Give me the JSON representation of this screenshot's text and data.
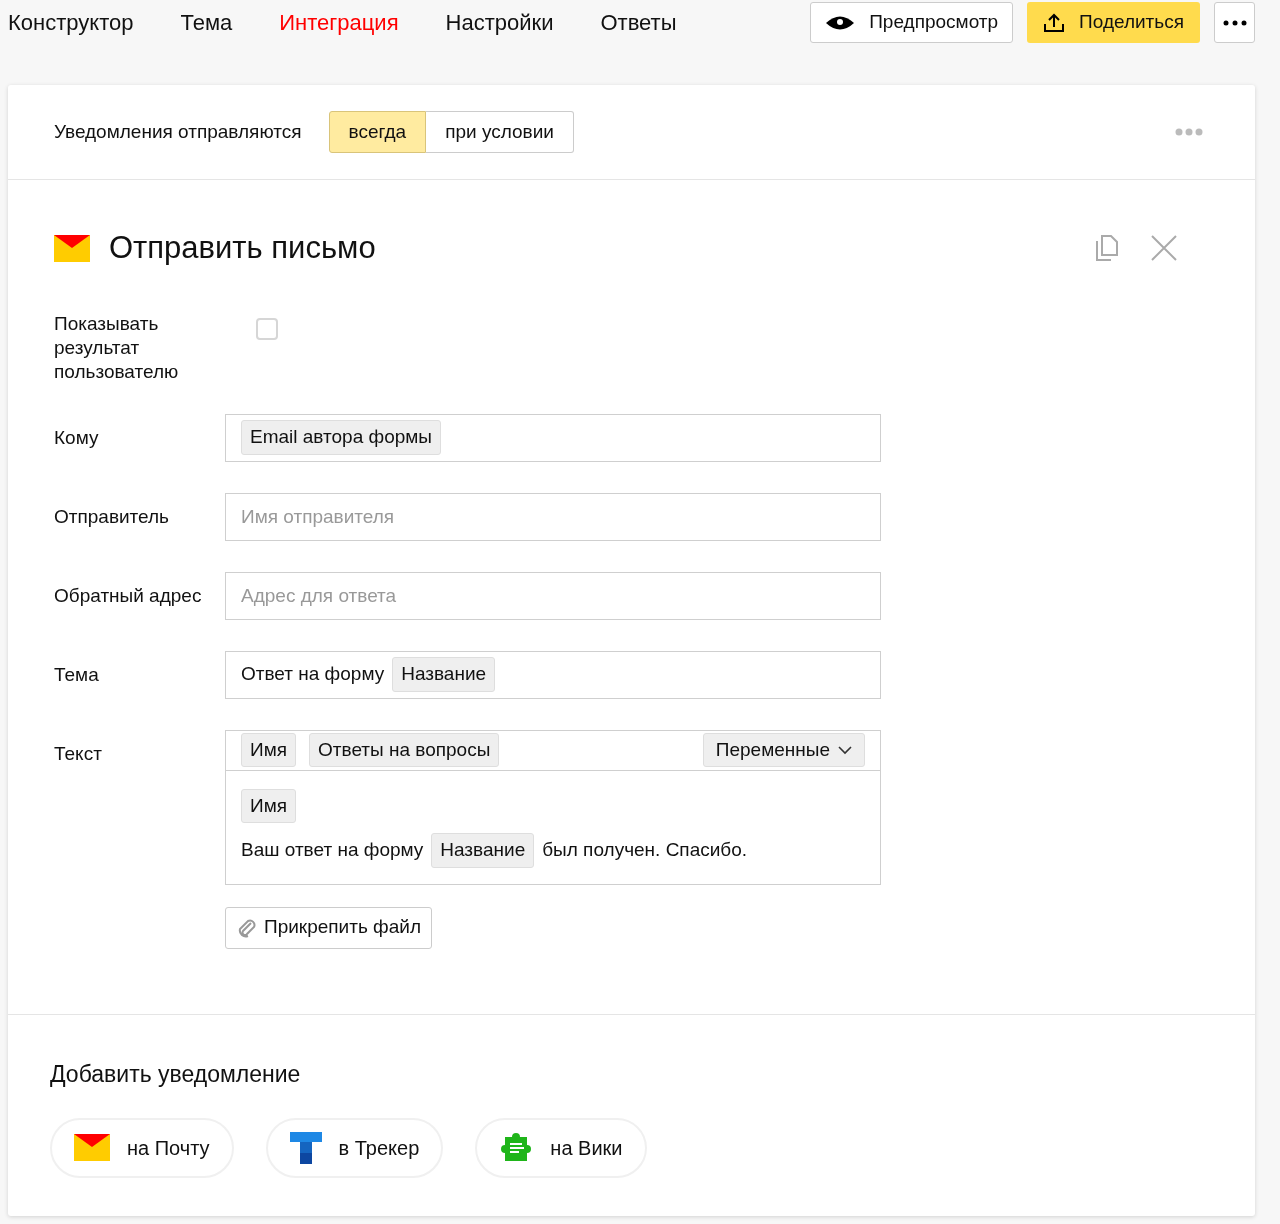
{
  "tabs": [
    {
      "label": "Конструктор",
      "selected": false
    },
    {
      "label": "Тема",
      "selected": false
    },
    {
      "label": "Интеграция",
      "selected": true
    },
    {
      "label": "Настройки",
      "selected": false
    },
    {
      "label": "Ответы",
      "selected": false
    }
  ],
  "preview_button": "Предпросмотр",
  "share_button": "Поделиться",
  "notifications": {
    "label": "Уведомления отправляются",
    "options": [
      {
        "label": "всегда",
        "selected": true
      },
      {
        "label": "при условии",
        "selected": false
      }
    ]
  },
  "action": {
    "title": "Отправить письмо",
    "fields": [
      {
        "kind": "checkbox",
        "label": "Показывать результат пользователю",
        "checked": false
      },
      {
        "kind": "tokens",
        "label": "Кому",
        "parts": [
          {
            "kind": "token",
            "text": "Email автора формы"
          }
        ]
      },
      {
        "kind": "input",
        "label": "Отправитель",
        "placeholder": "Имя отправителя"
      },
      {
        "kind": "input",
        "label": "Обратный адрес",
        "placeholder": "Адрес для ответа"
      },
      {
        "kind": "tokens",
        "label": "Тема",
        "parts": [
          {
            "kind": "text",
            "text": "Ответ на форму"
          },
          {
            "kind": "token",
            "text": "Название"
          }
        ]
      },
      {
        "kind": "editor",
        "label": "Текст",
        "toolbar": [
          "Имя",
          "Ответы на вопросы"
        ],
        "variables": "Переменные",
        "lines": [
          [
            {
              "kind": "token",
              "text": "Имя"
            }
          ],
          [
            {
              "kind": "text",
              "text": "Ваш ответ на форму"
            },
            {
              "kind": "token",
              "text": "Название"
            },
            {
              "kind": "text",
              "text": "был получен. Спасибо."
            }
          ]
        ]
      }
    ],
    "attach_button": "Прикрепить файл"
  },
  "add": {
    "title": "Добавить уведомление",
    "items": [
      {
        "kind": "mail",
        "label": "на Почту"
      },
      {
        "kind": "tracker",
        "label": "в Трекер"
      },
      {
        "kind": "wiki",
        "label": "на Вики"
      }
    ]
  }
}
